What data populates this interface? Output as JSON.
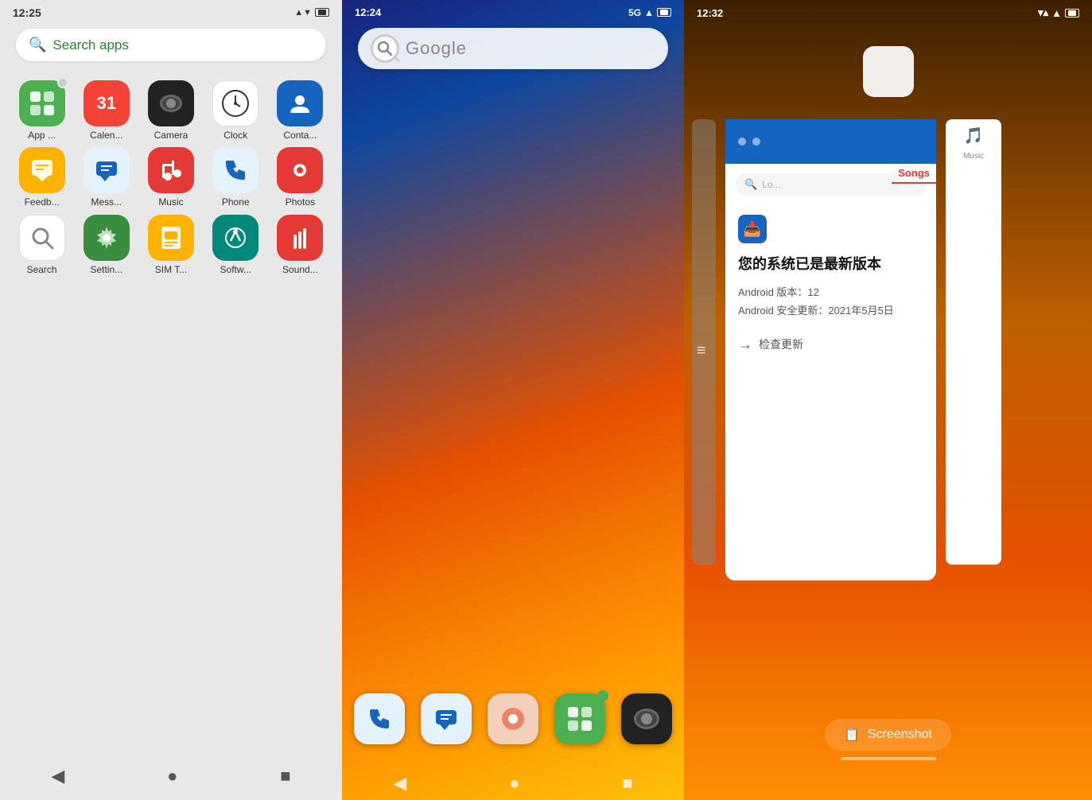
{
  "panel1": {
    "status": {
      "time": "12:25",
      "signal": "▲▼",
      "battery": "■"
    },
    "searchbar": {
      "placeholder": "Search apps"
    },
    "apps": [
      {
        "id": "appstore",
        "label": "App ...",
        "iconClass": "icon-appstore",
        "icon": "⊞",
        "hasBadge": true
      },
      {
        "id": "calendar",
        "label": "Calen...",
        "iconClass": "icon-calendar",
        "icon": "31",
        "hasBadge": false
      },
      {
        "id": "camera",
        "label": "Camera",
        "iconClass": "icon-camera",
        "icon": "📷",
        "hasBadge": false
      },
      {
        "id": "clock",
        "label": "Clock",
        "iconClass": "icon-clock",
        "icon": "⏱",
        "hasBadge": false
      },
      {
        "id": "contacts",
        "label": "Conta...",
        "iconClass": "icon-contacts",
        "icon": "👤",
        "hasBadge": false
      },
      {
        "id": "feedback",
        "label": "Feedb...",
        "iconClass": "icon-feedback",
        "icon": "💬",
        "hasBadge": false
      },
      {
        "id": "messages",
        "label": "Mess...",
        "iconClass": "icon-messages",
        "icon": "💬",
        "hasBadge": false
      },
      {
        "id": "music",
        "label": "Music",
        "iconClass": "icon-music",
        "icon": "♪",
        "hasBadge": false
      },
      {
        "id": "phone",
        "label": "Phone",
        "iconClass": "icon-phone",
        "icon": "📞",
        "hasBadge": false
      },
      {
        "id": "photos",
        "label": "Photos",
        "iconClass": "icon-photos",
        "icon": "🖼",
        "hasBadge": false
      },
      {
        "id": "search",
        "label": "Search",
        "iconClass": "icon-search",
        "icon": "🔍",
        "hasBadge": false
      },
      {
        "id": "settings",
        "label": "Settin...",
        "iconClass": "icon-settings",
        "icon": "⚙",
        "hasBadge": false
      },
      {
        "id": "simt",
        "label": "SIM T...",
        "iconClass": "icon-simt",
        "icon": "📱",
        "hasBadge": false
      },
      {
        "id": "software",
        "label": "Softw...",
        "iconClass": "icon-software",
        "icon": "↑",
        "hasBadge": false
      },
      {
        "id": "sound",
        "label": "Sound...",
        "iconClass": "icon-sound",
        "icon": "🔊",
        "hasBadge": false
      }
    ],
    "nav": {
      "back": "◀",
      "home": "●",
      "recents": "■"
    }
  },
  "panel2": {
    "status": {
      "time": "12:24",
      "network": "5G",
      "wifi": "📶",
      "battery": "■"
    },
    "search": {
      "placeholder": "Google"
    },
    "dock": [
      {
        "id": "phone",
        "icon": "📞",
        "color": "#e3f2fd",
        "hasBadge": false
      },
      {
        "id": "messages",
        "icon": "💬",
        "color": "#e3f2fd",
        "hasBadge": false
      },
      {
        "id": "photos",
        "icon": "🖼",
        "color": "#e8d5c4",
        "hasBadge": false
      },
      {
        "id": "appstore",
        "icon": "⊞",
        "color": "#4caf50",
        "hasBadge": true
      },
      {
        "id": "camera",
        "icon": "⚫",
        "color": "#222",
        "hasBadge": false
      }
    ],
    "nav": {
      "back": "◀",
      "home": "●",
      "recents": "■"
    }
  },
  "panel3": {
    "status": {
      "time": "12:32",
      "wifi": "📶",
      "battery": "■"
    },
    "topIcon": "",
    "systemUpdate": {
      "title": "您的系统已是最新版本",
      "androidVersion": "Android 版本：12",
      "securityUpdate": "Android 安全更新：2021年5月5日",
      "checkUpdate": "检查更新",
      "searchPlaceholder": "Lo...",
      "songsTab": "Songs"
    },
    "screenshot": {
      "label": "Screenshot",
      "icon": "📋"
    },
    "menuIcon": "≡"
  }
}
